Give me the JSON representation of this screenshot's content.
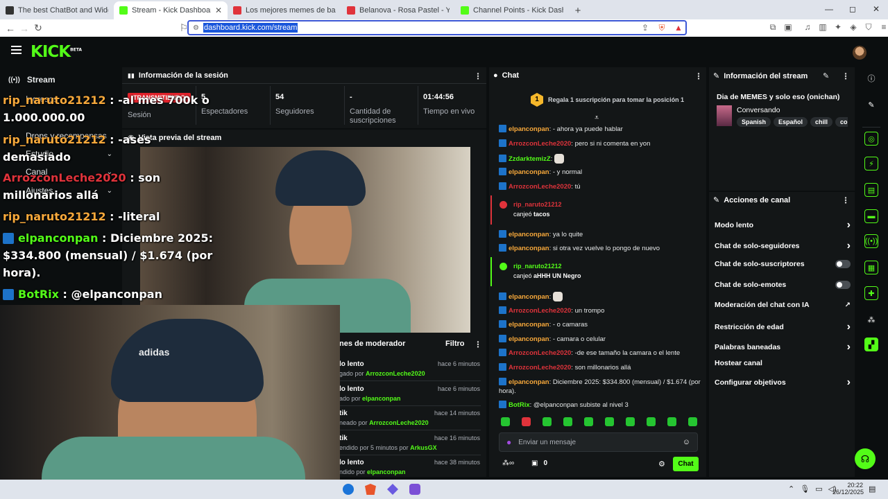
{
  "browser": {
    "tabs": [
      {
        "title": "The best ChatBot and Widgets for K",
        "color": "#333333"
      },
      {
        "title": "Stream - Kick Dashboard",
        "color": "#53fc18",
        "active": true
      },
      {
        "title": "Los mejores memes de baki parte 27",
        "color": "#e0333b"
      },
      {
        "title": "Belanova - Rosa Pastel - YouTube",
        "color": "#e0333b"
      },
      {
        "title": "Channel Points - Kick Dashboard",
        "color": "#53fc18"
      }
    ],
    "url": "dashboard.kick.com/stream",
    "win_min": "—",
    "win_max": "◻",
    "win_close": "✕"
  },
  "kick": {
    "logo": "KICK",
    "logo_badge": "BETA"
  },
  "sidebar": {
    "stream": "Stream",
    "items": [
      "Ingresos",
      "Drops y recompensas",
      "Estudio",
      "Canal",
      "Ajustes"
    ]
  },
  "session": {
    "title": "Información de la sesión",
    "status_badge": "TRANSMITIENDO",
    "status_label": "Sesión",
    "stats": [
      {
        "value": "5",
        "label": "Espectadores"
      },
      {
        "value": "54",
        "label": "Seguidores"
      },
      {
        "value": "-",
        "label": "Cantidad de suscripciones"
      },
      {
        "value": "01:44:56",
        "label": "Tiempo en vivo"
      }
    ]
  },
  "preview": {
    "title": "Vista previa del stream"
  },
  "modlog": {
    "title": "nes de moderador",
    "filter": "Filtro",
    "entries": [
      {
        "action": "lo lento",
        "sub": "gado por",
        "user": "ArrozconLeche2020",
        "time": "hace 6 minutos"
      },
      {
        "action": "lo lento",
        "sub": "ado por",
        "user": "elpanconpan",
        "time": "hace 6 minutos"
      },
      {
        "action": "tik",
        "sub": "neado por",
        "user": "ArrozconLeche2020",
        "time": "hace 14 minutos"
      },
      {
        "action": "tik",
        "sub": "endido por 5 minutos por",
        "user": "ArkusGX",
        "time": "hace 16 minutos"
      },
      {
        "action": "lo lento",
        "sub": "ndido por",
        "user": "elpanconpan",
        "time": "hace 38 minutos"
      }
    ]
  },
  "overlay": {
    "lines": [
      {
        "user": "rip_naruto21212",
        "text": " : -al mes 700k o",
        "cls": "o"
      },
      {
        "user": "",
        "text": "1.000.000.00",
        "cls": ""
      },
      {
        "user": "rip_naruto21212",
        "text": " : -ases",
        "cls": "o"
      },
      {
        "user": "",
        "text": "demasiado",
        "cls": ""
      },
      {
        "user": "ArrozconLeche2020",
        "text": " : son",
        "cls": "r"
      },
      {
        "user": "",
        "text": "millonarios allá",
        "cls": ""
      },
      {
        "user": "rip_naruto21212",
        "text": " : -literal",
        "cls": "o"
      },
      {
        "user": "elpanconpan",
        "text": " : Diciembre 2025:",
        "cls": "g"
      },
      {
        "user": "",
        "text": "$334.800 (mensual) / $1.674 (por",
        "cls": ""
      },
      {
        "user": "",
        "text": "hora).",
        "cls": ""
      },
      {
        "user": "BotRix",
        "text": " : @elpanconpan",
        "cls": "g"
      }
    ]
  },
  "chat": {
    "title": "Chat",
    "gift_num": "1",
    "gift_text": "Regala 1 suscripción para tomar la posición 1",
    "messages": [
      {
        "user": "elpanconpan",
        "cls": "o",
        "text": ": - ahora ya puede hablar"
      },
      {
        "user": "ArrozconLeche2020",
        "cls": "r",
        "text": ": pero si ni comenta en yon"
      },
      {
        "user": "ZzdarktemizZ",
        "cls": "g",
        "text": ":"
      },
      {
        "user": "elpanconpan",
        "cls": "o",
        "text": ": - y normal"
      },
      {
        "user": "ArrozconLeche2020",
        "cls": "r",
        "text": ": tú"
      },
      {
        "user": "elpanconpan",
        "cls": "o",
        "text": ": ya lo quite"
      },
      {
        "user": "elpanconpan",
        "cls": "o",
        "text": ": si otra vez vuelve lo pongo de nuevo"
      },
      {
        "user": "elpanconpan",
        "cls": "o",
        "text": ":"
      },
      {
        "user": "ArrozconLeche2020",
        "cls": "r",
        "text": ": un trompo"
      },
      {
        "user": "elpanconpan",
        "cls": "o",
        "text": ": - o camaras"
      },
      {
        "user": "elpanconpan",
        "cls": "o",
        "text": ": - camara o celular"
      },
      {
        "user": "ArrozconLeche2020",
        "cls": "r",
        "text": ": -de ese tamaño la camara o el lente"
      },
      {
        "user": "ArrozconLeche2020",
        "cls": "r",
        "text": ": son millonarios allá"
      },
      {
        "user": "elpanconpan",
        "cls": "o",
        "text": ": Diciembre 2025: $334.800 (mensual) / $1.674 (por"
      },
      {
        "user": "",
        "cls": "",
        "text": "hora)."
      },
      {
        "user": "BotRix",
        "cls": "g",
        "text": ": @elpanconpan subiste al nivel 3"
      }
    ],
    "redeems": [
      {
        "user": "rip_naruto21212",
        "cls": "r",
        "prefix": "canjeó ",
        "item": "tacos"
      },
      {
        "user": "rip_naruto21212",
        "cls": "g",
        "prefix": "canjeó ",
        "item": "aHHH UN Negro"
      }
    ],
    "input_placeholder": "Enviar un mensaje",
    "points": "0",
    "send": "Chat"
  },
  "stream_info": {
    "title": "Información del stream",
    "stream_title": "Dia de MEMES y solo eso (onichan)",
    "category": "Conversando",
    "tags": [
      "Spanish",
      "Español",
      "chill",
      "convers"
    ]
  },
  "actions": {
    "title": "Acciones de canal",
    "items": [
      {
        "label": "Modo lento",
        "kind": "chev"
      },
      {
        "label": "Chat de solo-seguidores",
        "kind": "chev"
      },
      {
        "label": "Chat de solo-suscriptores",
        "kind": "toggle"
      },
      {
        "label": "Chat de solo-emotes",
        "kind": "toggle"
      },
      {
        "label": "Moderación del chat con IA",
        "kind": "ext"
      },
      {
        "label": "Restricción de edad",
        "kind": "chev"
      },
      {
        "label": "Palabras baneadas",
        "kind": "chev"
      },
      {
        "label": "Hostear canal",
        "kind": "none"
      },
      {
        "label": "Configurar objetivos",
        "kind": "chev"
      }
    ]
  },
  "taskbar": {
    "time": "20:22",
    "date": "26/12/2025"
  },
  "colors": {
    "brand": "#53fc18",
    "panel": "#131617",
    "bg": "#0b0e0f"
  }
}
